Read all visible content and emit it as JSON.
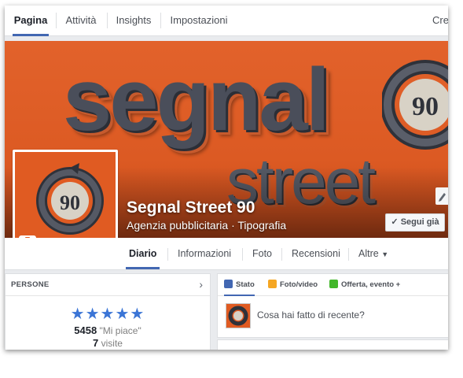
{
  "top_tabs": {
    "page": "Pagina",
    "activity": "Attività",
    "insights": "Insights",
    "settings": "Impostazioni",
    "create": "Crea"
  },
  "cover": {
    "word1": "segnal",
    "word2": "street",
    "logo_number": "90",
    "brand_color": "#e05b22"
  },
  "page": {
    "name": "Segnal Street 90",
    "category": "Agenzia pubblicitaria · Tipografia",
    "follow_label": "Segui già"
  },
  "nav": {
    "diary": "Diario",
    "info": "Informazioni",
    "photos": "Foto",
    "reviews": "Recensioni",
    "more": "Altre"
  },
  "people": {
    "title": "PERSONE",
    "rating_stars": 5,
    "likes_count": "5458",
    "likes_label": "\"Mi piace\"",
    "visits_count": "7",
    "visits_label": "visite"
  },
  "composer": {
    "status": "Stato",
    "photo_video": "Foto/video",
    "offer_event": "Offerta, evento +",
    "placeholder": "Cosa hai fatto di recente?"
  }
}
